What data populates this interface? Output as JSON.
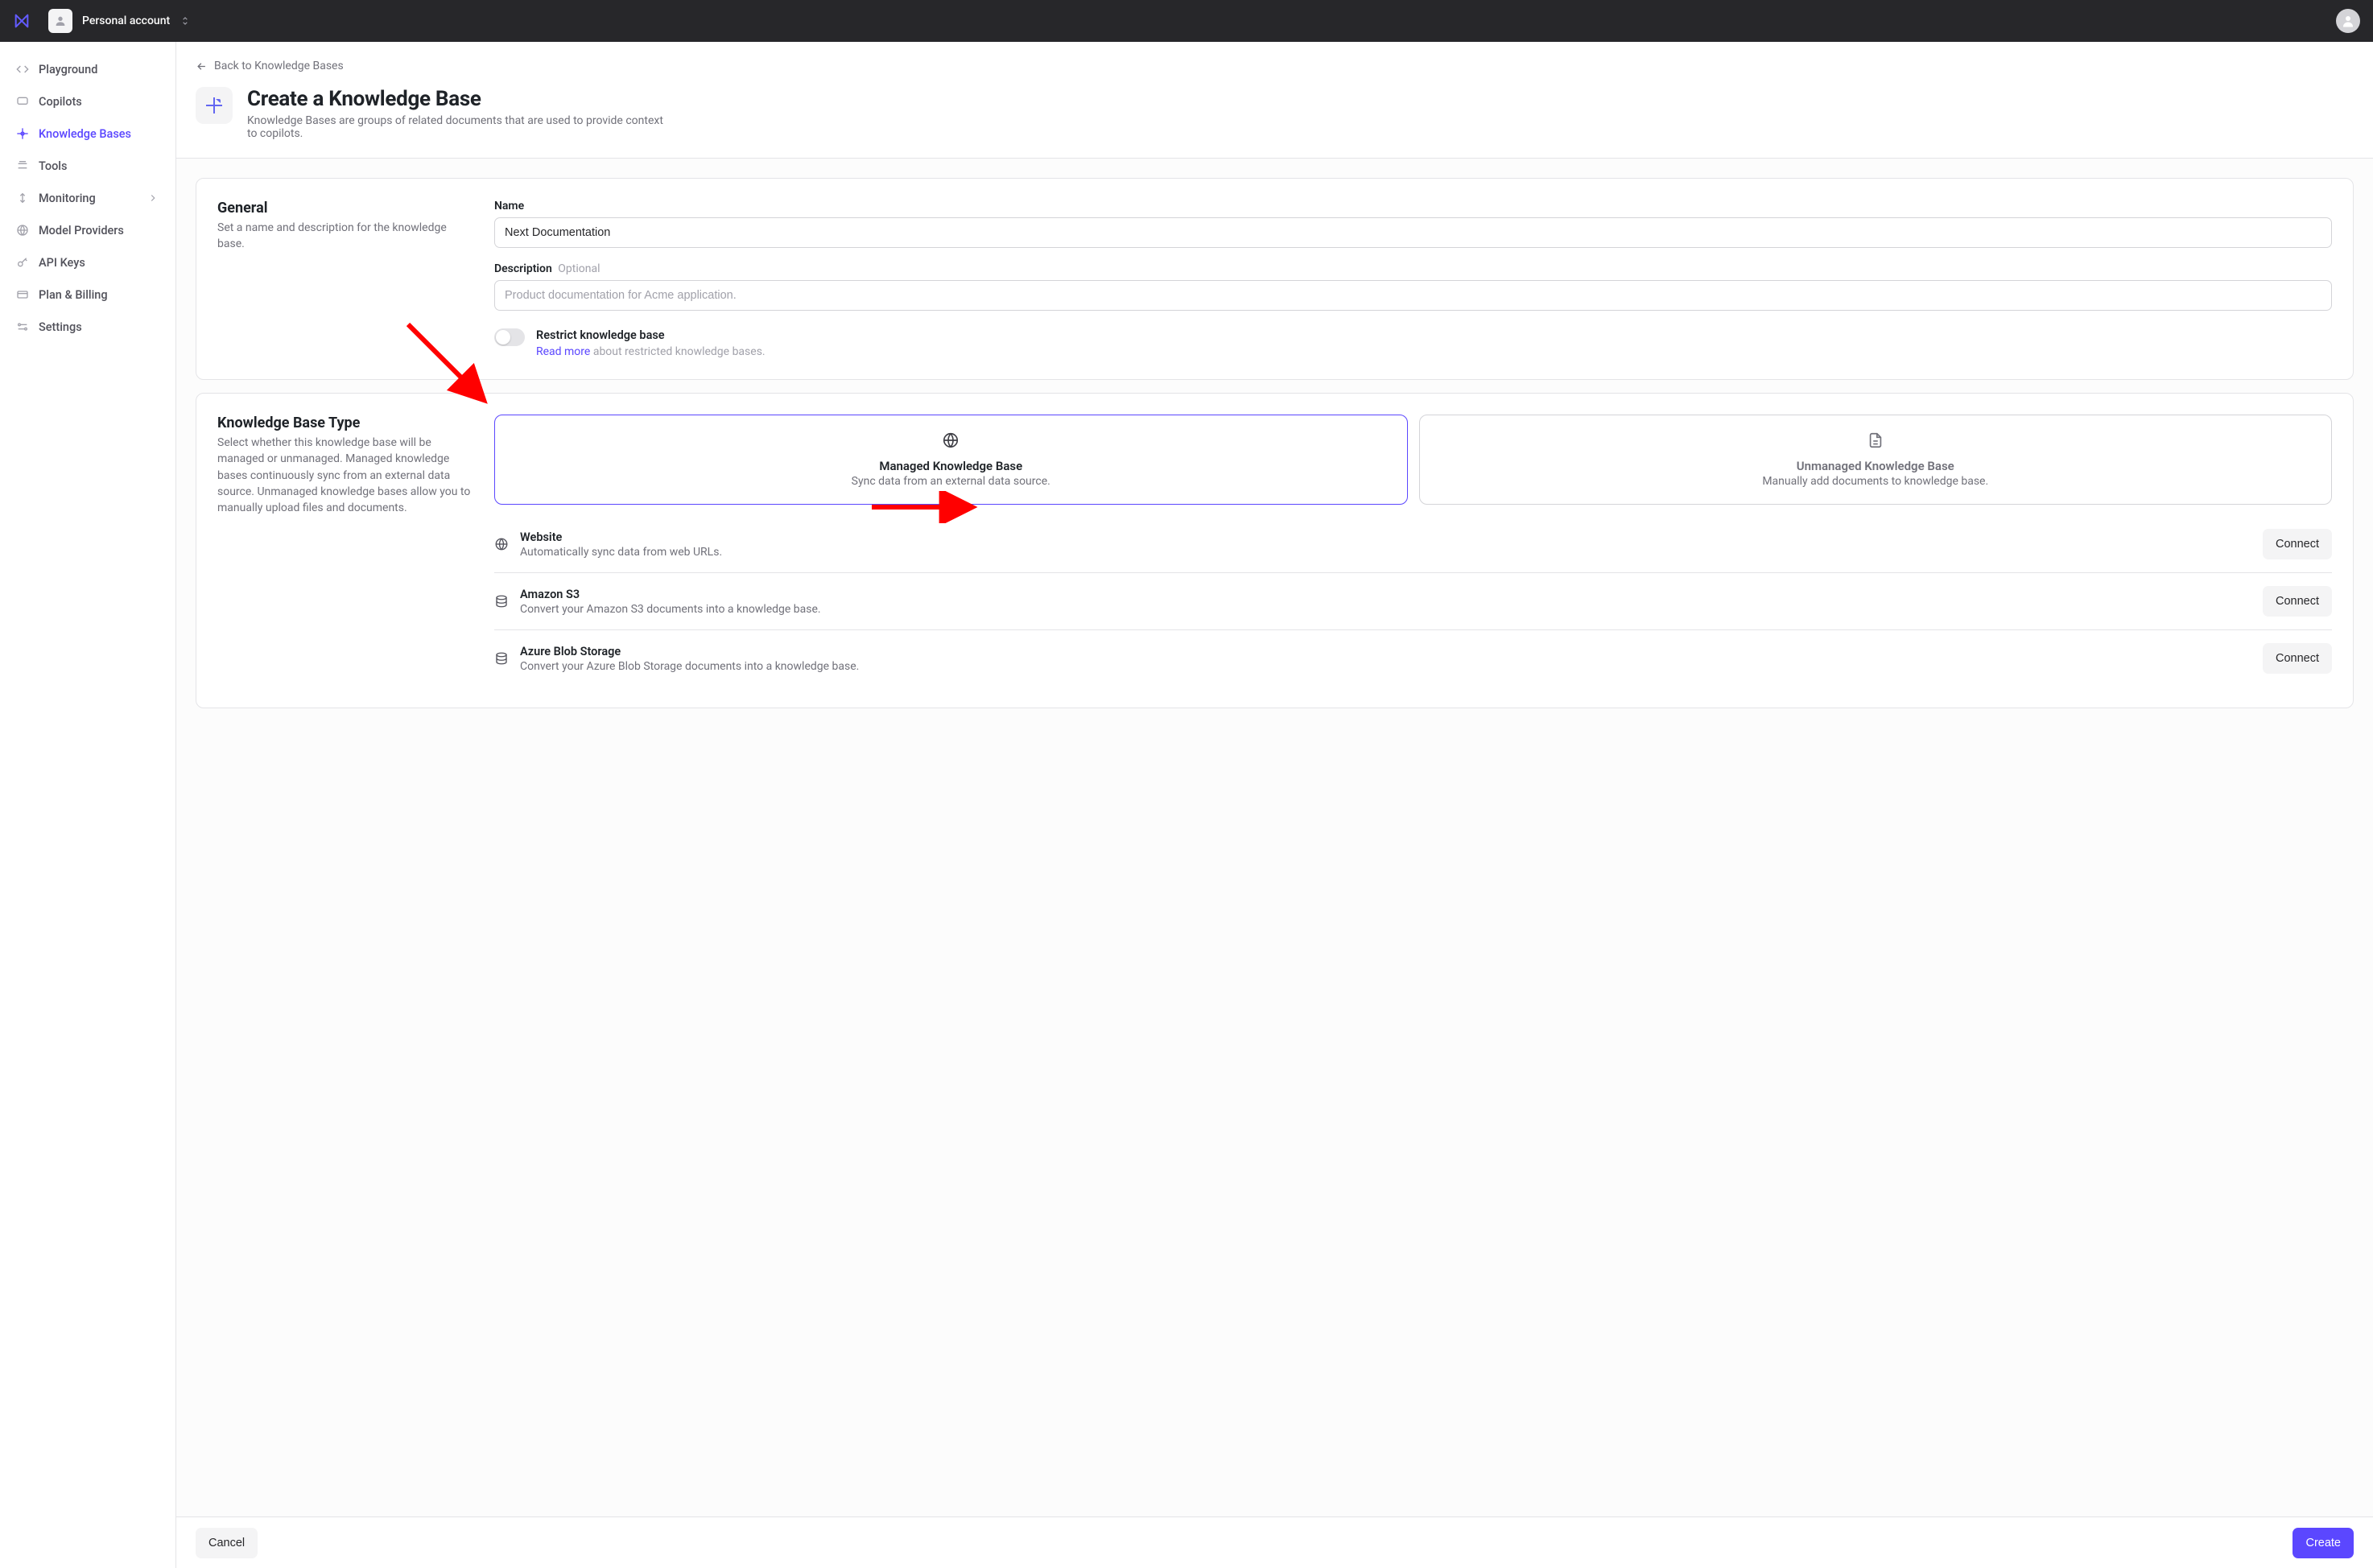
{
  "header": {
    "account_label": "Personal account"
  },
  "sidebar": {
    "items": [
      {
        "label": "Playground"
      },
      {
        "label": "Copilots"
      },
      {
        "label": "Knowledge Bases"
      },
      {
        "label": "Tools"
      },
      {
        "label": "Monitoring"
      },
      {
        "label": "Model Providers"
      },
      {
        "label": "API Keys"
      },
      {
        "label": "Plan & Billing"
      },
      {
        "label": "Settings"
      }
    ]
  },
  "page": {
    "back_label": "Back to Knowledge Bases",
    "title": "Create a Knowledge Base",
    "subtitle": "Knowledge Bases are groups of related documents that are used to provide context to copilots."
  },
  "general": {
    "heading": "General",
    "desc": "Set a name and description for the knowledge base.",
    "name_label": "Name",
    "name_value": "Next Documentation",
    "description_label": "Description",
    "description_optional": "Optional",
    "description_placeholder": "Product documentation for Acme application.",
    "restrict_title": "Restrict knowledge base",
    "restrict_readmore": "Read more",
    "restrict_about": "about restricted knowledge bases."
  },
  "kbtype": {
    "heading": "Knowledge Base Type",
    "desc": "Select whether this knowledge base will be managed or unmanaged. Managed knowledge bases continuously sync from an external data source. Unmanaged knowledge bases allow you to manually upload files and documents.",
    "managed_title": "Managed Knowledge Base",
    "managed_desc": "Sync data from an external data source.",
    "unmanaged_title": "Unmanaged Knowledge Base",
    "unmanaged_desc": "Manually add documents to knowledge base.",
    "sources": [
      {
        "title": "Website",
        "desc": "Automatically sync data from web URLs.",
        "button": "Connect"
      },
      {
        "title": "Amazon S3",
        "desc": "Convert your Amazon S3 documents into a knowledge base.",
        "button": "Connect"
      },
      {
        "title": "Azure Blob Storage",
        "desc": "Convert your Azure Blob Storage documents into a knowledge base.",
        "button": "Connect"
      }
    ]
  },
  "footer": {
    "cancel": "Cancel",
    "create": "Create"
  }
}
